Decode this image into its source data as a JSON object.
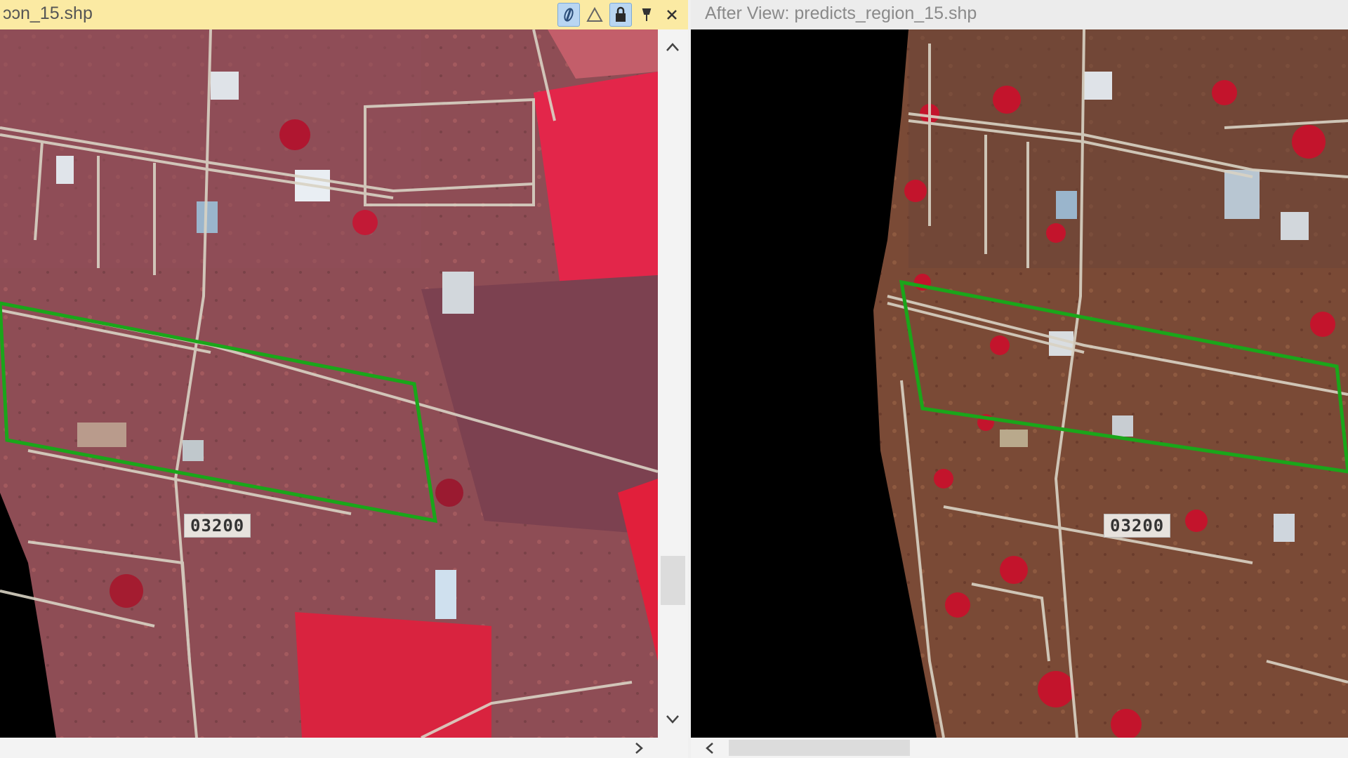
{
  "left_view": {
    "title": "ɔɔn_15.shp",
    "parcel_label": "03200",
    "toolbar": {
      "link_icon": "link-icon",
      "warning_icon": "warning-triangle-icon",
      "lock_icon": "lock-icon",
      "pin_icon": "pin-icon",
      "close_icon": "close-icon"
    }
  },
  "right_view": {
    "title": "After View: predicts_region_15.shp",
    "parcel_label": "03200"
  },
  "colors": {
    "selected_parcel_outline": "#1aa61a",
    "left_title_bar": "#fbeaa3",
    "right_title_bar": "#ececec"
  }
}
